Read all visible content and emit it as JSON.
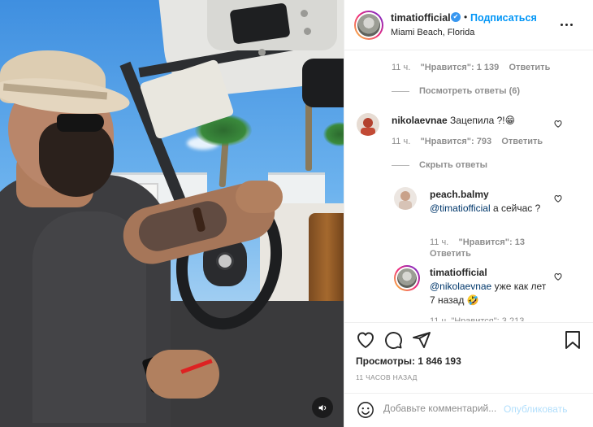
{
  "post": {
    "username": "timatiofficial",
    "verified_mark": "✔",
    "separator": "•",
    "follow_label": "Подписаться",
    "location": "Miami Beach, Florida"
  },
  "comments_top": {
    "time": "11 ч.",
    "likes": "\"Нравится\": 1 139",
    "reply_label": "Ответить",
    "view_replies": "Посмотреть ответы (6)"
  },
  "comment_main": {
    "username": "nikolaevnae",
    "text": "Зацепила ?!",
    "emoji": "😁",
    "time": "11 ч.",
    "likes": "\"Нравится\": 793",
    "reply_label": "Ответить",
    "hide_replies": "Скрыть ответы"
  },
  "replies": [
    {
      "username": "peach.balmy",
      "mention": "@timatiofficial",
      "text": " а сейчас ?",
      "time": "11 ч.",
      "likes": "\"Нравится\": 13",
      "reply_label": "Ответить"
    },
    {
      "username": "timatiofficial",
      "mention": "@nikolaevnae",
      "text": " уже как лет 7 назад",
      "emoji": "🤣",
      "partial_meta": "11 ч.   \"Нравится\": 3 213"
    }
  ],
  "footer": {
    "views_label": "Просмотры:",
    "views_count": "1 846 193",
    "time_ago": "11 ЧАСОВ НАЗАД",
    "comment_placeholder": "Добавьте комментарий...",
    "publish_label": "Опубликовать"
  },
  "colors": {
    "accent_blue": "#0095f6",
    "publish_disabled": "#b2dffc",
    "meta_gray": "#8e8e8e",
    "text": "#262626"
  },
  "icons": [
    "heart-icon",
    "comment-icon",
    "share-icon",
    "bookmark-icon",
    "emoji-icon",
    "more-icon",
    "sound-icon",
    "verified-icon"
  ]
}
